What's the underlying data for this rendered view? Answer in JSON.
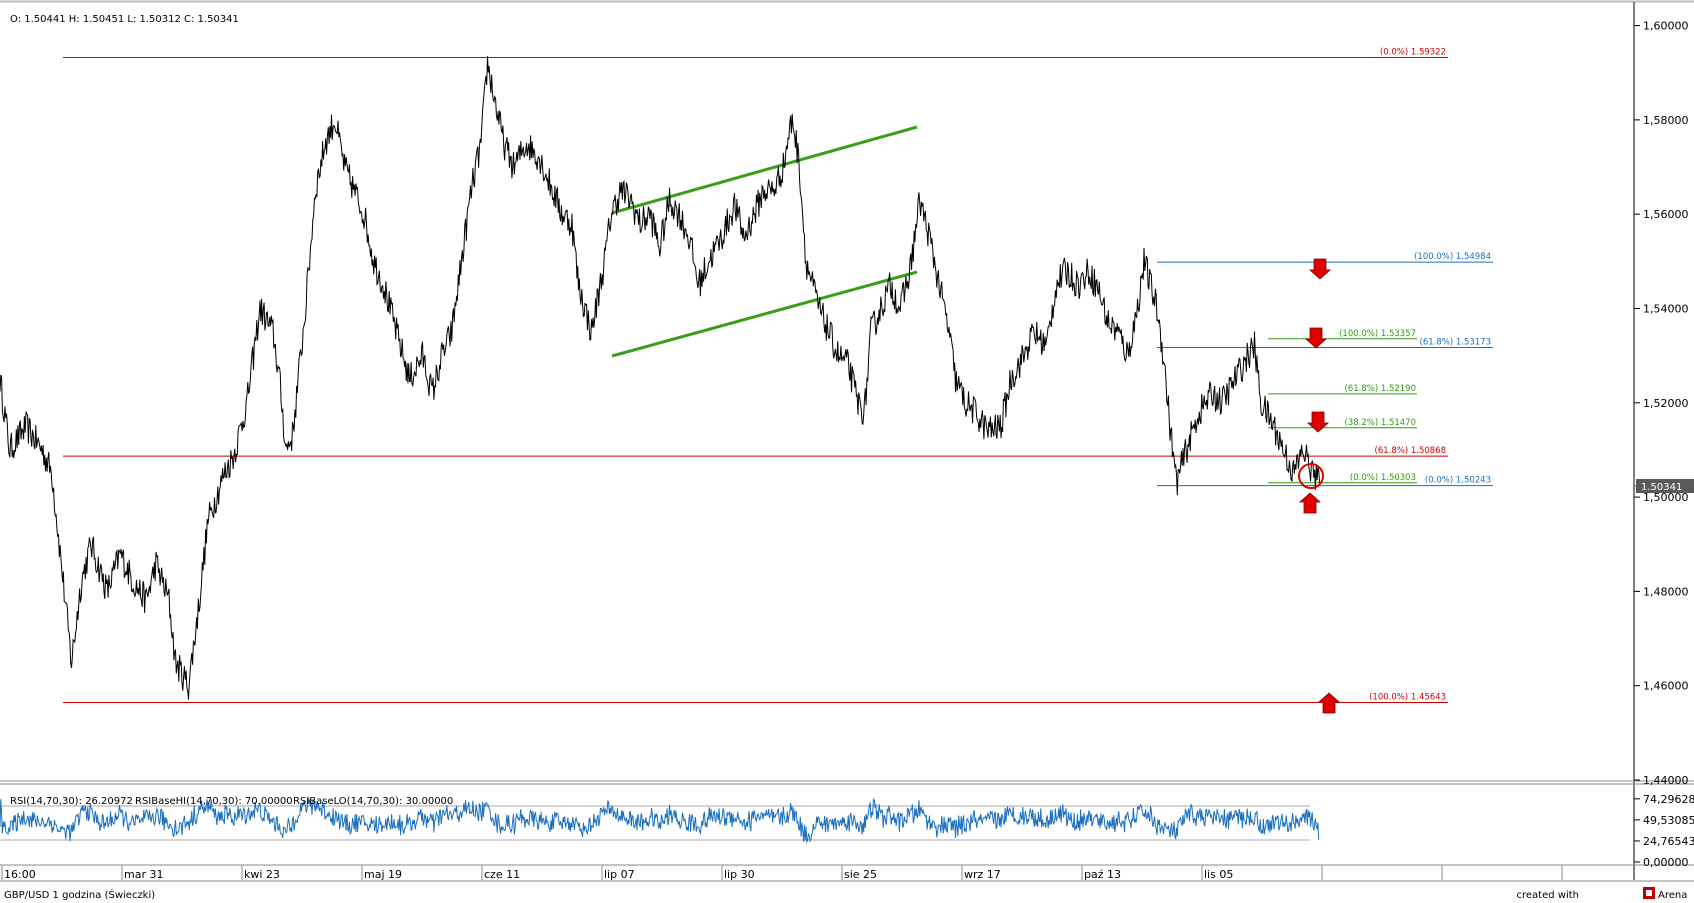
{
  "ohlc": {
    "label": "O: 1.50441 H: 1.50451 L: 1.50312 C: 1.50341"
  },
  "status_bar": {
    "title": "GBP/USD 1 godzina (Świeczki)",
    "created_with": "created with",
    "brand": "Arena"
  },
  "colors": {
    "price": "#000000",
    "red_levels": "#d00000",
    "blue_levels": "#1a6fc0",
    "green_levels": "#2f9a0f",
    "channel": "#3b9e1a",
    "rsi": "#1a6fc0",
    "arrow": "#e00000",
    "grid": "#a8a8a8"
  },
  "chart_data": [
    {
      "type": "line",
      "title": "",
      "instrument": "GBP/USD",
      "timeframe": "1 godzina",
      "y_ticks": [
        "1,60000",
        "1,58000",
        "1,56000",
        "1,54000",
        "1,52000",
        "1,50000",
        "1,48000",
        "1,46000",
        "1,44000"
      ],
      "ylim": [
        1.44,
        1.605
      ],
      "x_ticks": [
        "16:00",
        "mar 31",
        "kwi 23",
        "maj 19",
        "cze 11",
        "lip 07",
        "lip 30",
        "sie 25",
        "wrz 17",
        "paź 13",
        "lis 05"
      ],
      "current_price": 1.50341,
      "current_price_label": "1.50341",
      "series": [
        {
          "anchors": [
            [
              0,
              1.525
            ],
            [
              3,
              1.51
            ],
            [
              8,
              1.515
            ],
            [
              13,
              1.51
            ],
            [
              16,
              1.505
            ],
            [
              19,
              1.485
            ],
            [
              22,
              1.465
            ],
            [
              25,
              1.482
            ],
            [
              28,
              1.49
            ],
            [
              33,
              1.48
            ],
            [
              37,
              1.488
            ],
            [
              41,
              1.482
            ],
            [
              45,
              1.478
            ],
            [
              48,
              1.486
            ],
            [
              52,
              1.478
            ],
            [
              54,
              1.465
            ],
            [
              58,
              1.46
            ],
            [
              61,
              1.476
            ],
            [
              64,
              1.495
            ],
            [
              69,
              1.505
            ],
            [
              72,
              1.509
            ],
            [
              76,
              1.52
            ],
            [
              80,
              1.54
            ],
            [
              84,
              1.535
            ],
            [
              86,
              1.525
            ],
            [
              88,
              1.51
            ],
            [
              90,
              1.513
            ],
            [
              94,
              1.54
            ],
            [
              97,
              1.565
            ],
            [
              100,
              1.575
            ],
            [
              103,
              1.58
            ],
            [
              106,
              1.57
            ],
            [
              109,
              1.565
            ],
            [
              112,
              1.56
            ],
            [
              115,
              1.55
            ],
            [
              118,
              1.545
            ],
            [
              122,
              1.535
            ],
            [
              126,
              1.525
            ],
            [
              130,
              1.53
            ],
            [
              133,
              1.522
            ],
            [
              136,
              1.53
            ],
            [
              139,
              1.535
            ],
            [
              142,
              1.55
            ],
            [
              145,
              1.565
            ],
            [
              148,
              1.575
            ],
            [
              150,
              1.592
            ],
            [
              152,
              1.585
            ],
            [
              155,
              1.575
            ],
            [
              158,
              1.57
            ],
            [
              162,
              1.575
            ],
            [
              166,
              1.572
            ],
            [
              170,
              1.565
            ],
            [
              173,
              1.56
            ],
            [
              176,
              1.558
            ],
            [
              178,
              1.545
            ],
            [
              180,
              1.54
            ],
            [
              182,
              1.535
            ],
            [
              186,
              1.55
            ],
            [
              188,
              1.56
            ],
            [
              191,
              1.565
            ],
            [
              194,
              1.563
            ],
            [
              197,
              1.558
            ],
            [
              200,
              1.56
            ],
            [
              203,
              1.553
            ],
            [
              206,
              1.563
            ],
            [
              209,
              1.56
            ],
            [
              212,
              1.555
            ],
            [
              215,
              1.545
            ],
            [
              218,
              1.55
            ],
            [
              222,
              1.555
            ],
            [
              226,
              1.562
            ],
            [
              229,
              1.555
            ],
            [
              232,
              1.56
            ],
            [
              235,
              1.565
            ],
            [
              238,
              1.565
            ],
            [
              241,
              1.57
            ],
            [
              243,
              1.578
            ],
            [
              244,
              1.58
            ],
            [
              246,
              1.57
            ],
            [
              248,
              1.55
            ],
            [
              250,
              1.545
            ],
            [
              252,
              1.54
            ],
            [
              255,
              1.535
            ],
            [
              258,
              1.53
            ],
            [
              261,
              1.528
            ],
            [
              264,
              1.52
            ],
            [
              266,
              1.518
            ],
            [
              268,
              1.535
            ],
            [
              271,
              1.54
            ],
            [
              274,
              1.545
            ],
            [
              277,
              1.54
            ],
            [
              280,
              1.548
            ],
            [
              283,
              1.563
            ],
            [
              286,
              1.555
            ],
            [
              289,
              1.545
            ],
            [
              292,
              1.535
            ],
            [
              294,
              1.525
            ],
            [
              297,
              1.52
            ],
            [
              300,
              1.518
            ],
            [
              304,
              1.514
            ],
            [
              308,
              1.515
            ],
            [
              311,
              1.525
            ],
            [
              315,
              1.53
            ],
            [
              318,
              1.535
            ],
            [
              322,
              1.532
            ],
            [
              325,
              1.545
            ],
            [
              328,
              1.548
            ],
            [
              332,
              1.545
            ],
            [
              335,
              1.548
            ],
            [
              338,
              1.544
            ],
            [
              341,
              1.537
            ],
            [
              344,
              1.535
            ],
            [
              347,
              1.53
            ],
            [
              350,
              1.54
            ],
            [
              352,
              1.55
            ],
            [
              354,
              1.545
            ],
            [
              356,
              1.54
            ],
            [
              358,
              1.53
            ],
            [
              360,
              1.515
            ],
            [
              362,
              1.503
            ],
            [
              365,
              1.51
            ],
            [
              369,
              1.518
            ],
            [
              373,
              1.522
            ],
            [
              376,
              1.52
            ],
            [
              380,
              1.525
            ],
            [
              384,
              1.53
            ],
            [
              386,
              1.532
            ],
            [
              388,
              1.52
            ],
            [
              392,
              1.515
            ],
            [
              395,
              1.51
            ],
            [
              398,
              1.505
            ],
            [
              401,
              1.51
            ],
            [
              404,
              1.505
            ],
            [
              406,
              1.503
            ]
          ]
        }
      ]
    },
    {
      "type": "line",
      "title": "",
      "indicator": "RSI",
      "legend": [
        "RSI(14,70,30): 26.20972",
        "RSIBaseHI(14,70,30): 70.00000",
        "RSIBaseLO(14,70,30): 30.00000"
      ],
      "y_ticks": [
        "74,29628",
        "49,53085",
        "24,76543",
        "0,00000"
      ],
      "ylim": [
        0,
        80
      ],
      "base_hi": 70,
      "base_lo": 30,
      "last_value": 26.20972
    }
  ],
  "levels": {
    "red": [
      {
        "label": "(0.0%) 1.59322",
        "value": 1.59322
      },
      {
        "label": "(61.8%) 1.50868",
        "value": 1.50868
      },
      {
        "label": "(100.0%) 1.45643",
        "value": 1.45643
      }
    ],
    "blue": [
      {
        "label": "(100.0%) 1.54984",
        "value": 1.54984
      },
      {
        "label": "(61.8%) 1.53173",
        "value": 1.53173
      },
      {
        "label": "(0.0%) 1.50243",
        "value": 1.50243
      }
    ],
    "green": [
      {
        "label": "(100.0%) 1.53357",
        "value": 1.53357
      },
      {
        "label": "(61.8%) 1.52190",
        "value": 1.5219
      },
      {
        "label": "(38.2%) 1.51470",
        "value": 1.5147
      },
      {
        "label": "(0.0%) 1.50303",
        "value": 1.50303
      }
    ]
  }
}
